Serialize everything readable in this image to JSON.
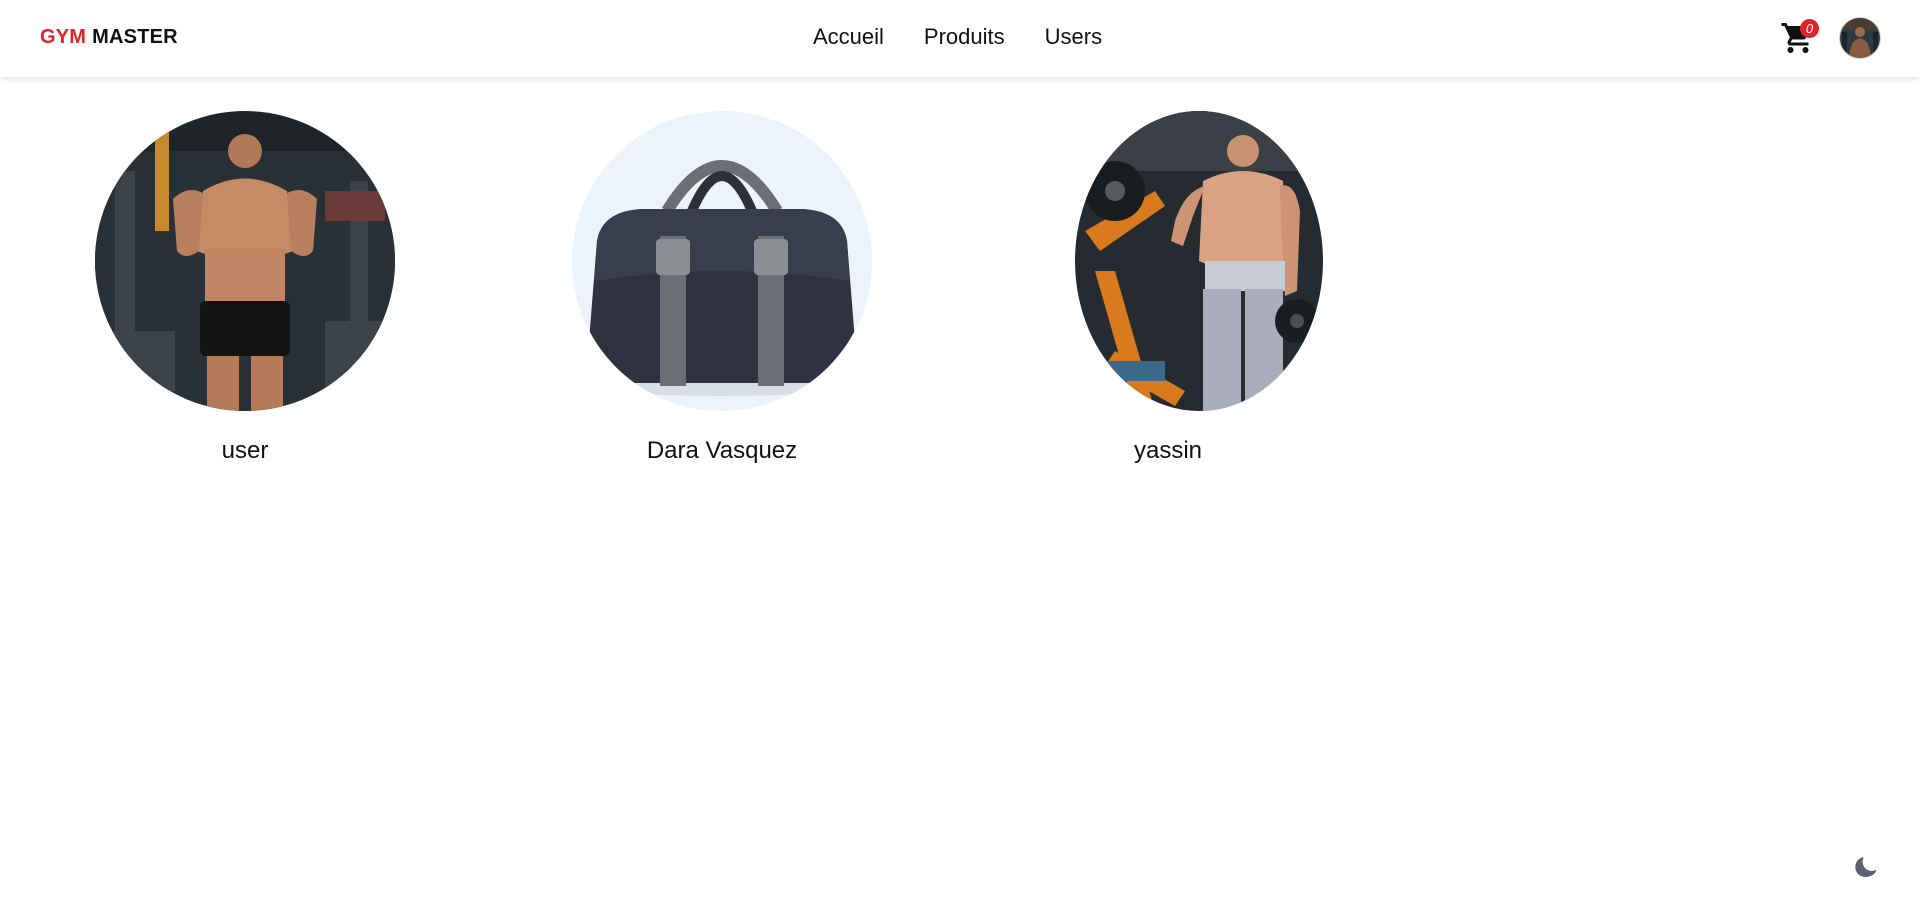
{
  "brand": {
    "part1": "GYM",
    "part2": "MASTER",
    "accent_color": "#e0242b"
  },
  "nav": {
    "links": [
      {
        "label": "Accueil"
      },
      {
        "label": "Produits"
      },
      {
        "label": "Users"
      }
    ]
  },
  "cart": {
    "icon": "cart-icon",
    "count": "0"
  },
  "profile": {
    "icon": "avatar"
  },
  "users": [
    {
      "name": "user",
      "image": "bodybuilder-in-gym-photo"
    },
    {
      "name": "Dara Vasquez",
      "image": "gym-duffel-bag-photo"
    },
    {
      "name": "yassin",
      "image": "athlete-in-gym-photo"
    }
  ],
  "theme_toggle": {
    "icon": "moon-icon"
  }
}
